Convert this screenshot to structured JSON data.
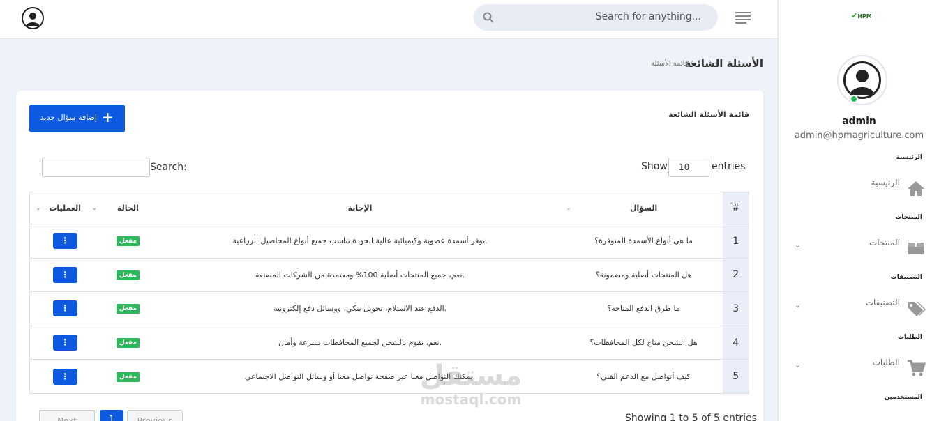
{
  "topbar": {
    "search_placeholder": "Search for anything..."
  },
  "sidebar": {
    "logo_text": "HPM",
    "user_name": "admin",
    "user_email": "admin@hpmagriculture.com",
    "sections": [
      {
        "title": "الرئيسية",
        "item": "الرئيسية",
        "icon": "home-icon",
        "has_chevron": false
      },
      {
        "title": "المنتجات",
        "item": "المنتجات",
        "icon": "box-icon",
        "has_chevron": true
      },
      {
        "title": "التصنيفات",
        "item": "التصنيفات",
        "icon": "tag-icon",
        "has_chevron": true
      },
      {
        "title": "الطلبات",
        "item": "الطلبات",
        "icon": "cart-icon",
        "has_chevron": true
      },
      {
        "title": "المستخدمين"
      }
    ]
  },
  "page": {
    "title": "الأسئلة الشائعة",
    "breadcrumb": "قائمة الأسئلة /"
  },
  "card": {
    "title": "قائمة الأسئلة الشائعة",
    "add_button": "إضافة سؤال جديد",
    "show_label": "Show",
    "show_value": "10",
    "entries_label": "entries",
    "search_label": "Search:",
    "info": "Showing 1 to 5 of 5 entries",
    "pagination": {
      "prev": "Previous",
      "current": "1",
      "next": "Next"
    }
  },
  "table": {
    "headers": {
      "num": "#",
      "question": "السؤال",
      "answer": "الإجابة",
      "status": "الحالة",
      "actions": "العمليات"
    },
    "rows": [
      {
        "num": "1",
        "question": "ما هي أنواع الأسمدة المتوفرة؟",
        "answer": "نوفر أسمدة عضوية وكيميائية عالية الجودة تناسب جميع أنواع المحاصيل الزراعية.",
        "status": "مفعل"
      },
      {
        "num": "2",
        "question": "هل المنتجات أصلية ومضمونة؟",
        "answer": "نعم، جميع المنتجات أصلية 100% ومعتمدة من الشركات المصنعة.",
        "status": "مفعل"
      },
      {
        "num": "3",
        "question": "ما طرق الدفع المتاحة؟",
        "answer": "الدفع عند الاستلام، تحويل بنكي، ووسائل دفع إلكترونية.",
        "status": "مفعل"
      },
      {
        "num": "4",
        "question": "هل الشحن متاح لكل المحافظات؟",
        "answer": "نعم، نقوم بالشحن لجميع المحافظات بسرعة وأمان.",
        "status": "مفعل"
      },
      {
        "num": "5",
        "question": "كيف أتواصل مع الدعم الفني؟",
        "answer": "يمكنك التواصل معنا عبر صفحة تواصل معنا أو وسائل التواصل الاجتماعي.",
        "status": "مفعل"
      }
    ]
  },
  "watermark": {
    "line1": "مستقل",
    "line2": "mostaql.com"
  },
  "colors": {
    "primary": "#0d5ae0",
    "success": "#2eb85c",
    "background": "#eef2f9"
  }
}
